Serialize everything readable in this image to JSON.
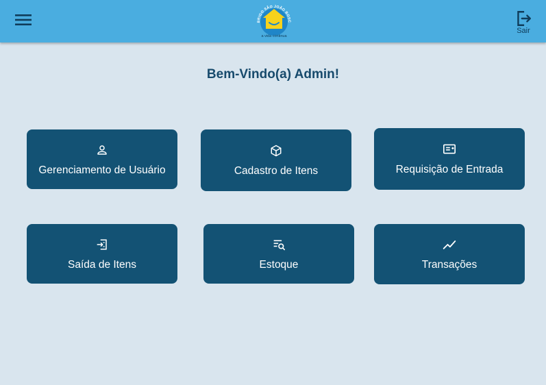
{
  "header": {
    "menu_icon": "hamburger-menu-icon",
    "logo": {
      "arc_text": "ABRIGO SÃO JOÃO BOSCO",
      "tagline": "a vida continua"
    },
    "logout": {
      "icon": "logout-icon",
      "label": "Sair"
    }
  },
  "welcome_text": "Bem-Vindo(a) Admin!",
  "tiles": [
    {
      "label": "Gerenciamento de Usuário",
      "icon": "user-icon"
    },
    {
      "label": "Cadastro de Itens",
      "icon": "box-icon"
    },
    {
      "label": "Requisição de Entrada",
      "icon": "receipt-icon"
    },
    {
      "label": "Saída de Itens",
      "icon": "exit-items-icon"
    },
    {
      "label": "Estoque",
      "icon": "inventory-search-icon"
    },
    {
      "label": "Transações",
      "icon": "trending-line-icon"
    }
  ],
  "colors": {
    "header_bg": "#4aade0",
    "page_bg": "#d9e5ee",
    "tile_bg": "#135274",
    "title_text": "#174a6c",
    "logo_yellow": "#f6d21c",
    "logo_blue": "#1f86c8"
  }
}
